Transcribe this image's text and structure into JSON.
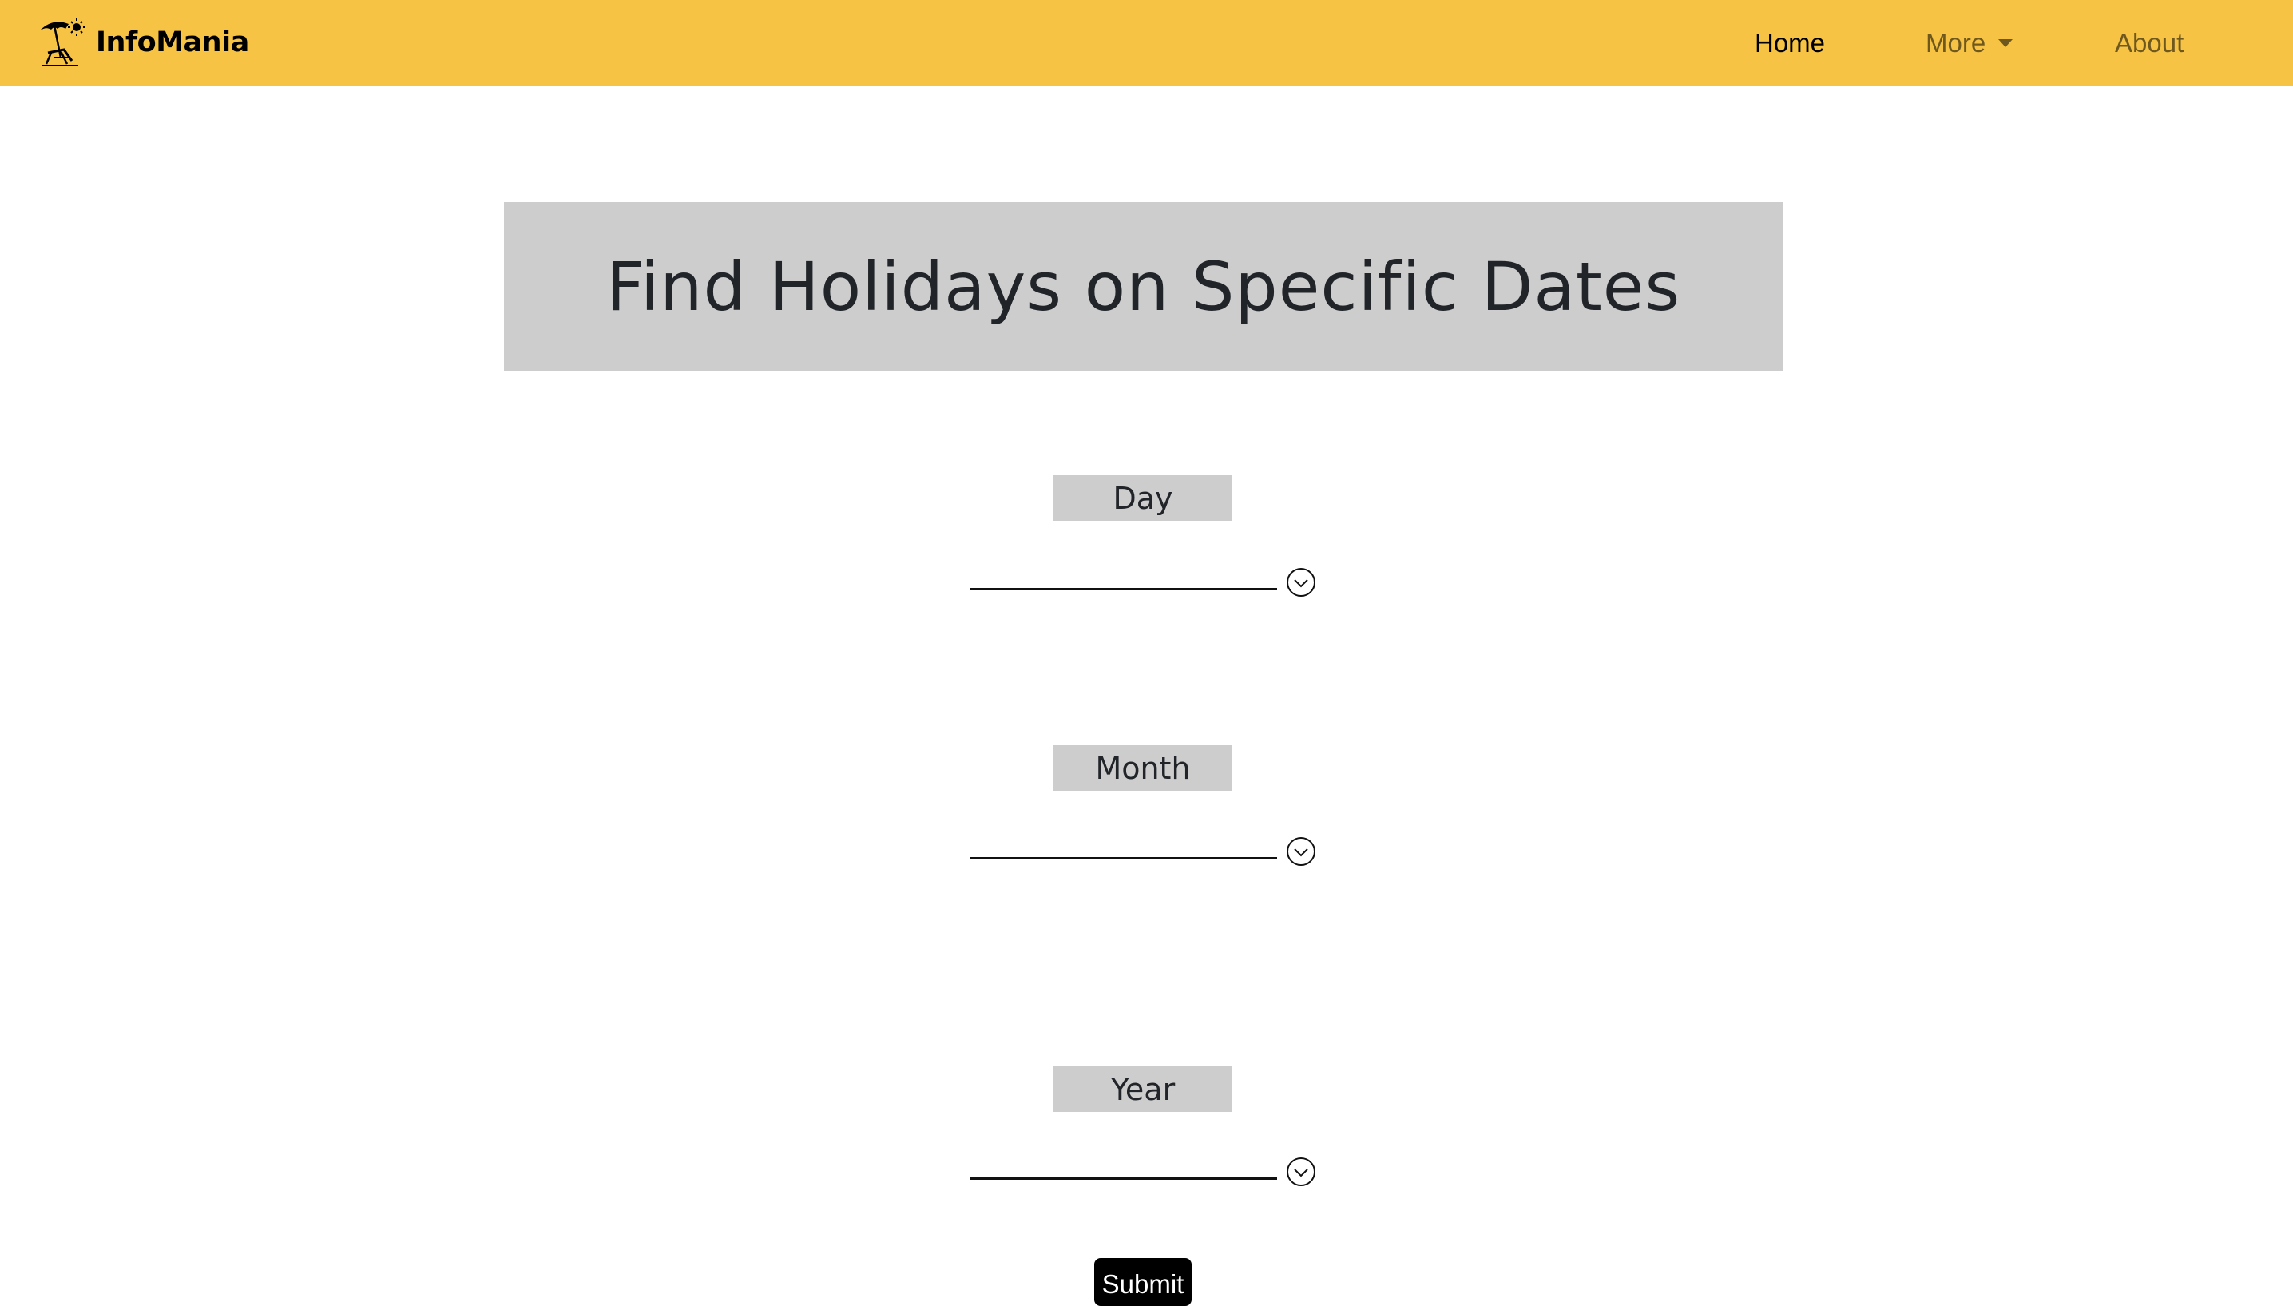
{
  "brand": {
    "name": "InfoMania",
    "logo_icon": "beach-umbrella-chair-icon"
  },
  "nav": {
    "home": "Home",
    "more": "More",
    "about": "About"
  },
  "colors": {
    "navbar_bg": "#f6c344",
    "label_bg": "#cdcdcd",
    "submit_bg": "#000000"
  },
  "page": {
    "title": "Find Holidays on Specific Dates"
  },
  "form": {
    "day": {
      "label": "Day",
      "value": ""
    },
    "month": {
      "label": "Month",
      "value": ""
    },
    "year": {
      "label": "Year",
      "value": ""
    },
    "submit_label": "Submit"
  }
}
